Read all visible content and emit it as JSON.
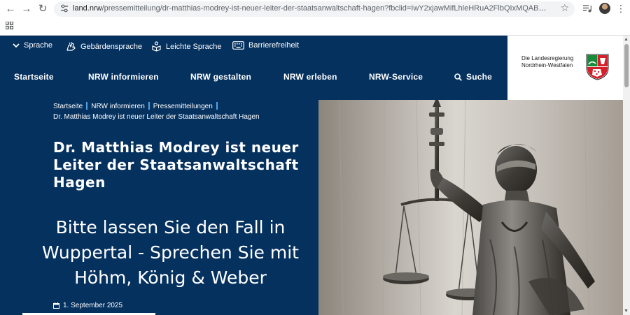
{
  "browser": {
    "url_domain": "land.nrw",
    "url_path": "/pressemitteilung/dr-matthias-modrey-ist-neuer-leiter-der-staatsanwaltschaft-hagen?fbclid=IwY2xjawMifLhleHRuA2FlbQIxMQABHhCuhrhOjR7hFDHnWWoAY..."
  },
  "topbar": {
    "sprache": "Sprache",
    "gebaerdensprache": "Gebärdensprache",
    "leichte_sprache": "Leichte Sprache",
    "barrierefreiheit": "Barrierefreiheit"
  },
  "mainnav": {
    "startseite": "Startseite",
    "informieren": "NRW informieren",
    "gestalten": "NRW gestalten",
    "erleben": "NRW erleben",
    "service": "NRW-Service",
    "suche": "Suche"
  },
  "logo": {
    "line1": "Die Landesregierung",
    "line2": "Nordrhein-Westfalen"
  },
  "breadcrumb": {
    "items": [
      "Startseite",
      "NRW informieren",
      "Pressemitteilungen"
    ],
    "current": "Dr. Matthias Modrey ist neuer Leiter der Staatsanwaltschaft Hagen"
  },
  "article": {
    "headline": "Dr. Matthias Modrey ist neuer Leiter der Staatsanwaltschaft Hagen",
    "overlay_ad": "Bitte lassen Sie den Fall in Wuppertal - Sprechen Sie mit Höhm, König & Weber",
    "date": "1. September 2025"
  },
  "colors": {
    "brand_blue": "#05315f",
    "breadcrumb_separator": "#4ca3e8"
  }
}
